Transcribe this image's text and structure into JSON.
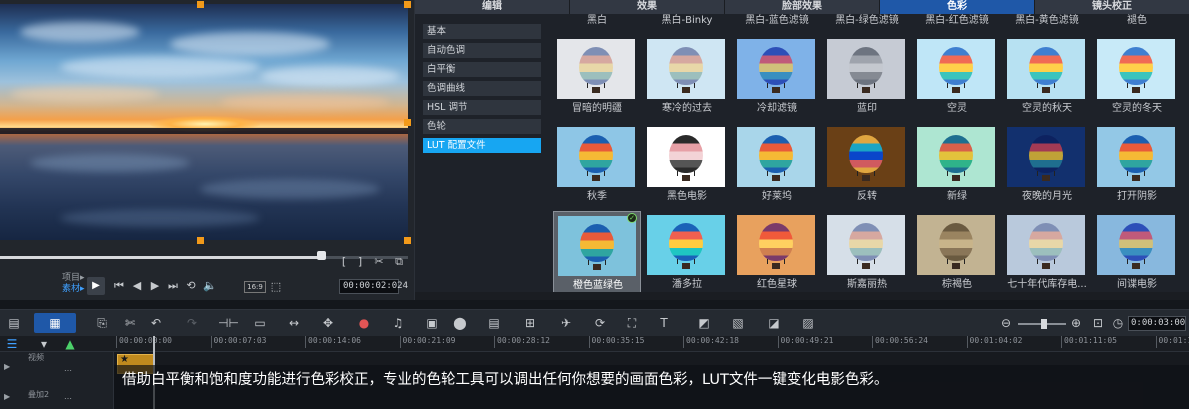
{
  "preview": {
    "mode_line1": "项目▸",
    "mode_line2": "素材▸",
    "resolution": "16:9",
    "timecode": "00:00:02:024"
  },
  "panel": {
    "tabs": [
      "编辑",
      "效果",
      "脸部效果",
      "色彩",
      "镜头校正"
    ],
    "active_tab": "色彩",
    "categories": [
      "基本",
      "自动色调",
      "白平衡",
      "色调曲线",
      "HSL 调节",
      "色轮",
      "LUT 配置文件"
    ],
    "active_category": "LUT 配置文件",
    "top_row_labels": [
      "黑白",
      "黑白-Binky",
      "黑白-蓝色滤镜",
      "黑白-绿色滤镜",
      "黑白-红色滤镜",
      "黑白-黄色滤镜",
      "褪色"
    ],
    "presets": [
      {
        "label": "冒暗的明疆",
        "tint": "#e4e6ea",
        "style": "pale"
      },
      {
        "label": "寒冷的过去",
        "tint": "#cfe6f3",
        "style": "pale"
      },
      {
        "label": "冷却滤镜",
        "tint": "#7fb2e8",
        "style": "cool"
      },
      {
        "label": "蓝印",
        "tint": "#c6cbd4",
        "style": "mono"
      },
      {
        "label": "空灵",
        "tint": "#bfe6f7",
        "style": "bright"
      },
      {
        "label": "空灵的秋天",
        "tint": "#b7e1f2",
        "style": "bright"
      },
      {
        "label": "空灵的冬天",
        "tint": "#c8eaf8",
        "style": "bright"
      },
      {
        "label": "秋季",
        "tint": "#8ec6e6",
        "style": "normal"
      },
      {
        "label": "黑色电影",
        "tint": "#ffffff",
        "style": "mono-pink"
      },
      {
        "label": "好莱坞",
        "tint": "#a9d6ea",
        "style": "normal"
      },
      {
        "label": "反转",
        "tint": "#6a4016",
        "style": "invert"
      },
      {
        "label": "新绿",
        "tint": "#aee6d2",
        "style": "green"
      },
      {
        "label": "夜晚的月光",
        "tint": "#12306e",
        "style": "night"
      },
      {
        "label": "打开阴影",
        "tint": "#93c8e6",
        "style": "normal"
      },
      {
        "label": "橙色蓝绿色",
        "tint": "#7ec2dc",
        "style": "normal"
      },
      {
        "label": "潘多拉",
        "tint": "#68d0e8",
        "style": "teal"
      },
      {
        "label": "红色星球",
        "tint": "#e8a15e",
        "style": "warm"
      },
      {
        "label": "斯嘉丽热",
        "tint": "#d6dfe8",
        "style": "pale"
      },
      {
        "label": "棕褐色",
        "tint": "#c2b392",
        "style": "sepia"
      },
      {
        "label": "七十年代库存电...",
        "tint": "#b9c9dc",
        "style": "pale"
      },
      {
        "label": "间谍电影",
        "tint": "#88b8de",
        "style": "cool"
      }
    ],
    "selected_preset": "橙色蓝绿色"
  },
  "toolbar": {
    "timecode": "0:00:03:00",
    "zoom_percent": 55
  },
  "ruler": [
    "00:00:00:00",
    "00:00:07:03",
    "00:00:14:06",
    "00:00:21:09",
    "00:00:28:12",
    "00:00:35:15",
    "00:00:42:18",
    "00:00:49:21",
    "00:00:56:24",
    "00:01:04:02",
    "00:01:11:05",
    "00:01:1"
  ],
  "tracks": {
    "video_label": "视频",
    "overlay_label": "叠加2"
  },
  "caption": "借助白平衡和饱和度功能进行色彩校正，专业的色轮工具可以调出任何你想要的画面色彩，LUT文件一键变化电影色彩。",
  "icons": [
    "play-icon",
    "prev-icon",
    "step-back-icon",
    "step-forward-icon",
    "next-icon",
    "repeat-icon",
    "volume-icon",
    "undo-icon",
    "redo-icon",
    "zoom-in-icon",
    "zoom-out-icon"
  ]
}
